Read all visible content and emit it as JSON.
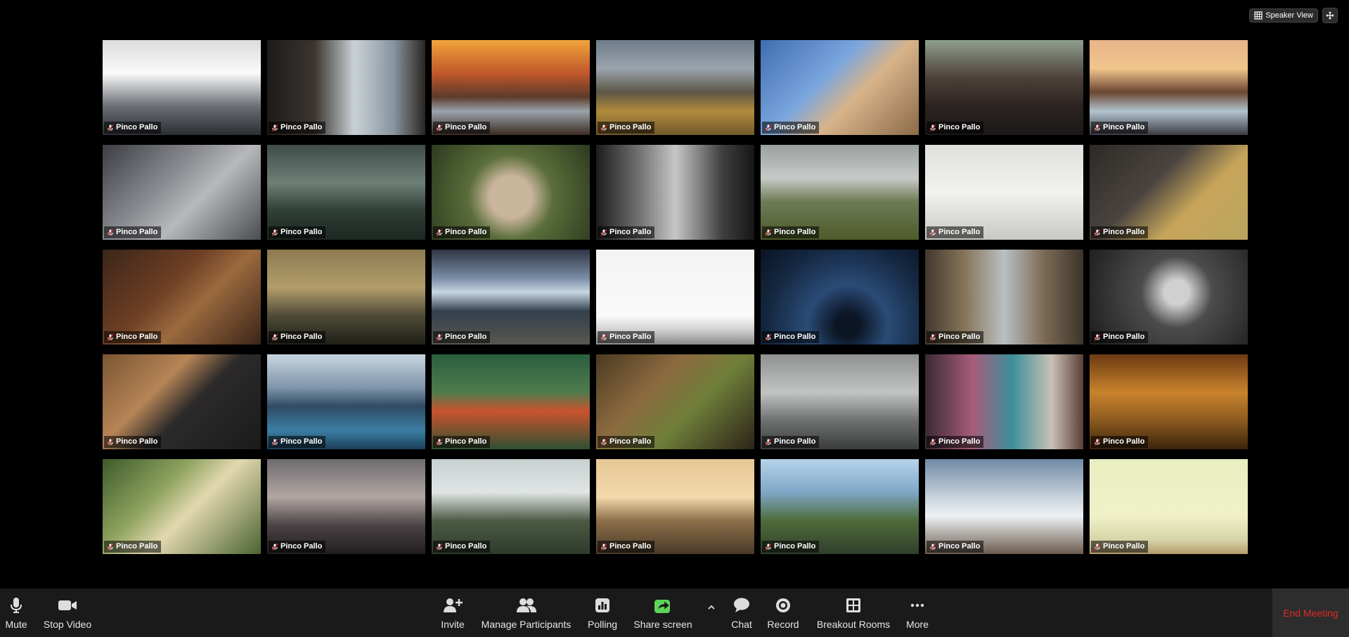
{
  "header": {
    "speaker_view_label": "Speaker View"
  },
  "participants": [
    {
      "name": "Pinco Pallo",
      "muted": true
    },
    {
      "name": "Pinco Pallo",
      "muted": true
    },
    {
      "name": "Pinco Pallo",
      "muted": true
    },
    {
      "name": "Pinco Pallo",
      "muted": true
    },
    {
      "name": "Pinco Pallo",
      "muted": true
    },
    {
      "name": "Pinco Pallo",
      "muted": true
    },
    {
      "name": "Pinco Pallo",
      "muted": true
    },
    {
      "name": "Pinco Pallo",
      "muted": true
    },
    {
      "name": "Pinco Pallo",
      "muted": true
    },
    {
      "name": "Pinco Pallo",
      "muted": true
    },
    {
      "name": "Pinco Pallo",
      "muted": true
    },
    {
      "name": "Pinco Pallo",
      "muted": true
    },
    {
      "name": "Pinco Pallo",
      "muted": true
    },
    {
      "name": "Pinco Pallo",
      "muted": true
    },
    {
      "name": "Pinco Pallo",
      "muted": true
    },
    {
      "name": "Pinco Pallo",
      "muted": true
    },
    {
      "name": "Pinco Pallo",
      "muted": true
    },
    {
      "name": "Pinco Pallo",
      "muted": true
    },
    {
      "name": "Pinco Pallo",
      "muted": true
    },
    {
      "name": "Pinco Pallo",
      "muted": true
    },
    {
      "name": "Pinco Pallo",
      "muted": true
    },
    {
      "name": "Pinco Pallo",
      "muted": true
    },
    {
      "name": "Pinco Pallo",
      "muted": true
    },
    {
      "name": "Pinco Pallo",
      "muted": true
    },
    {
      "name": "Pinco Pallo",
      "muted": true
    },
    {
      "name": "Pinco Pallo",
      "muted": true
    },
    {
      "name": "Pinco Pallo",
      "muted": true
    },
    {
      "name": "Pinco Pallo",
      "muted": true
    },
    {
      "name": "Pinco Pallo",
      "muted": true
    },
    {
      "name": "Pinco Pallo",
      "muted": true
    },
    {
      "name": "Pinco Pallo",
      "muted": true
    },
    {
      "name": "Pinco Pallo",
      "muted": true
    },
    {
      "name": "Pinco Pallo",
      "muted": true
    },
    {
      "name": "Pinco Pallo",
      "muted": true
    },
    {
      "name": "Pinco Pallo",
      "muted": true
    }
  ],
  "toolbar": {
    "mute": "Mute",
    "stop_video": "Stop Video",
    "invite": "Invite",
    "manage_participants": "Manage Participants",
    "polling": "Polling",
    "share_screen": "Share screen",
    "chat": "Chat",
    "record": "Record",
    "breakout_rooms": "Breakout Rooms",
    "more": "More",
    "end_meeting": "End Meeting"
  },
  "colors": {
    "share_green": "#5bd65b",
    "end_red": "#e02828",
    "toolbar_bg": "#1a1a1a"
  }
}
